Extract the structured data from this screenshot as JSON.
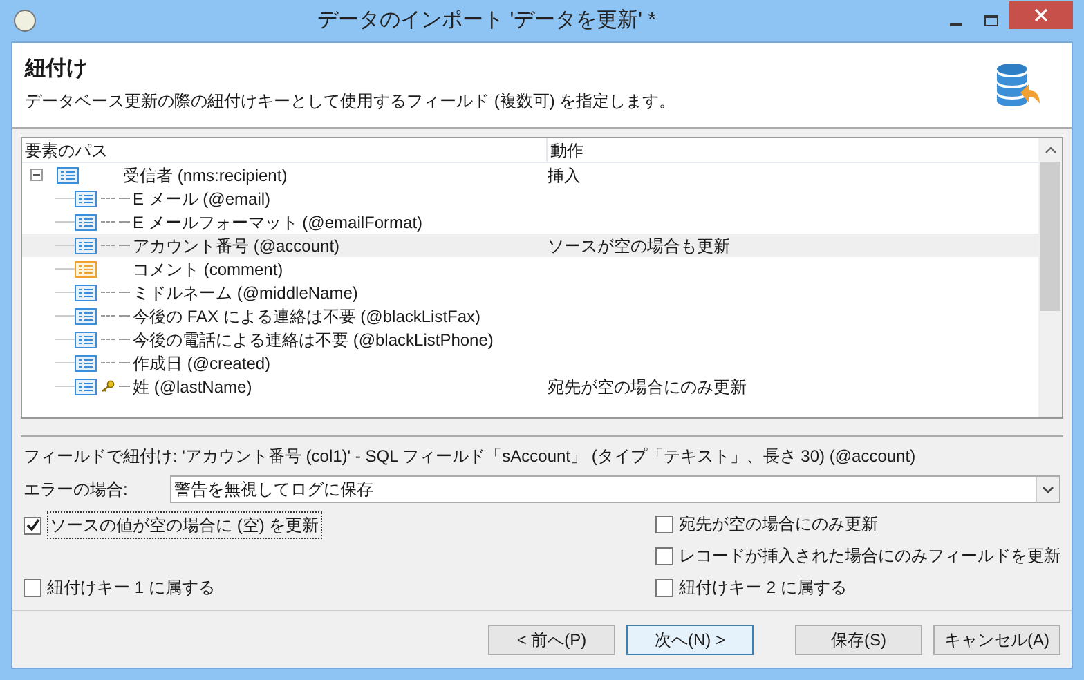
{
  "window": {
    "title": "データのインポート 'データを更新'  *"
  },
  "header": {
    "title": "紐付け",
    "description": "データベース更新の際の紐付けキーとして使用するフィールド (複数可) を指定します。"
  },
  "tree": {
    "columns": [
      "要素のパス",
      "動作"
    ],
    "rows": [
      {
        "label": "受信者 (nms:recipient)",
        "action": "挿入",
        "selected": false,
        "expanded": true,
        "children": [
          {
            "label": "E メール (@email)",
            "kind": "attribute",
            "key": false,
            "selected": false
          },
          {
            "label": "E メールフォーマット (@emailFormat)",
            "kind": "attribute",
            "key": false,
            "selected": false
          },
          {
            "label": "アカウント番号 (@account)",
            "action": "ソースが空の場合も更新",
            "kind": "attribute",
            "key": false,
            "selected": true
          },
          {
            "label": "コメント (comment)",
            "kind": "memo",
            "key": false,
            "selected": false
          },
          {
            "label": "ミドルネーム (@middleName)",
            "kind": "attribute",
            "key": false,
            "selected": false
          },
          {
            "label": "今後の FAX による連絡は不要 (@blackListFax)",
            "kind": "attribute",
            "key": false,
            "selected": false
          },
          {
            "label": "今後の電話による連絡は不要 (@blackListPhone)",
            "kind": "attribute",
            "key": false,
            "selected": false
          },
          {
            "label": "作成日 (@created)",
            "kind": "attribute",
            "key": false,
            "selected": false
          },
          {
            "label": "姓 (@lastName)",
            "action": "宛先が空の場合にのみ更新",
            "kind": "attribute",
            "key": true,
            "selected": false
          }
        ]
      }
    ]
  },
  "link_info": "フィールドで紐付け: 'アカウント番号 (col1)' - SQL フィールド「sAccount」 (タイプ「テキスト」、長さ 30) (@account)",
  "on_error": {
    "label": "エラーの場合:",
    "value": "警告を無視してログに保存"
  },
  "options_left": [
    {
      "label": "ソースの値が空の場合に (空) を更新",
      "checked": true
    },
    {
      "label": "紐付けキー 1 に属する",
      "checked": false
    }
  ],
  "options_right": [
    {
      "label": "宛先が空の場合にのみ更新",
      "checked": false
    },
    {
      "label": "レコードが挿入された場合にのみフィールドを更新",
      "checked": false
    },
    {
      "label": "紐付けキー 2 に属する",
      "checked": false
    }
  ],
  "buttons": [
    "< 前へ(P)",
    "次へ(N) >",
    "保存(S)",
    "キャンセル(A)"
  ]
}
